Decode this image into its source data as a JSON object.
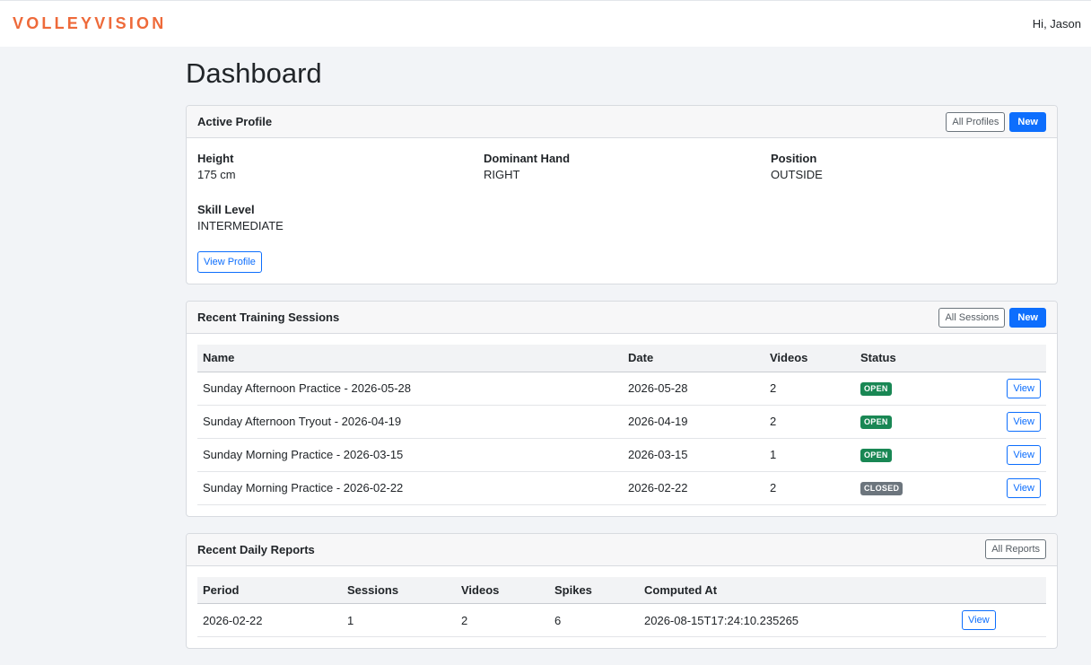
{
  "nav": {
    "brand": "VOLLEYVISION",
    "greeting": "Hi, Jason"
  },
  "page": {
    "title": "Dashboard"
  },
  "profile": {
    "title": "Active Profile",
    "all_label": "All Profiles",
    "new_label": "New",
    "fields": [
      {
        "label": "Height",
        "value": "175 cm"
      },
      {
        "label": "Dominant Hand",
        "value": "RIGHT"
      },
      {
        "label": "Position",
        "value": "OUTSIDE"
      },
      {
        "label": "Skill Level",
        "value": "INTERMEDIATE"
      }
    ],
    "view_label": "View Profile"
  },
  "sessions": {
    "title": "Recent Training Sessions",
    "all_label": "All Sessions",
    "new_label": "New",
    "columns": [
      "Name",
      "Date",
      "Videos",
      "Status"
    ],
    "rows": [
      {
        "name": "Sunday Afternoon Practice - 2026-05-28",
        "date": "2026-05-28",
        "videos": "2",
        "status": "OPEN",
        "view": "View"
      },
      {
        "name": "Sunday Afternoon Tryout - 2026-04-19",
        "date": "2026-04-19",
        "videos": "2",
        "status": "OPEN",
        "view": "View"
      },
      {
        "name": "Sunday Morning Practice - 2026-03-15",
        "date": "2026-03-15",
        "videos": "1",
        "status": "OPEN",
        "view": "View"
      },
      {
        "name": "Sunday Morning Practice - 2026-02-22",
        "date": "2026-02-22",
        "videos": "2",
        "status": "CLOSED",
        "view": "View"
      }
    ]
  },
  "reports": {
    "title": "Recent Daily Reports",
    "all_label": "All Reports",
    "columns": [
      "Period",
      "Sessions",
      "Videos",
      "Spikes",
      "Computed At"
    ],
    "rows": [
      {
        "period": "2026-02-22",
        "sessions": "1",
        "videos": "2",
        "spikes": "6",
        "computed_at": "2026-08-15T17:24:10.235265",
        "view": "View"
      }
    ]
  },
  "colors": {
    "brand": "#ee6a3a",
    "primary": "#0d6efd",
    "open": "#198754",
    "closed": "#6c757d"
  }
}
